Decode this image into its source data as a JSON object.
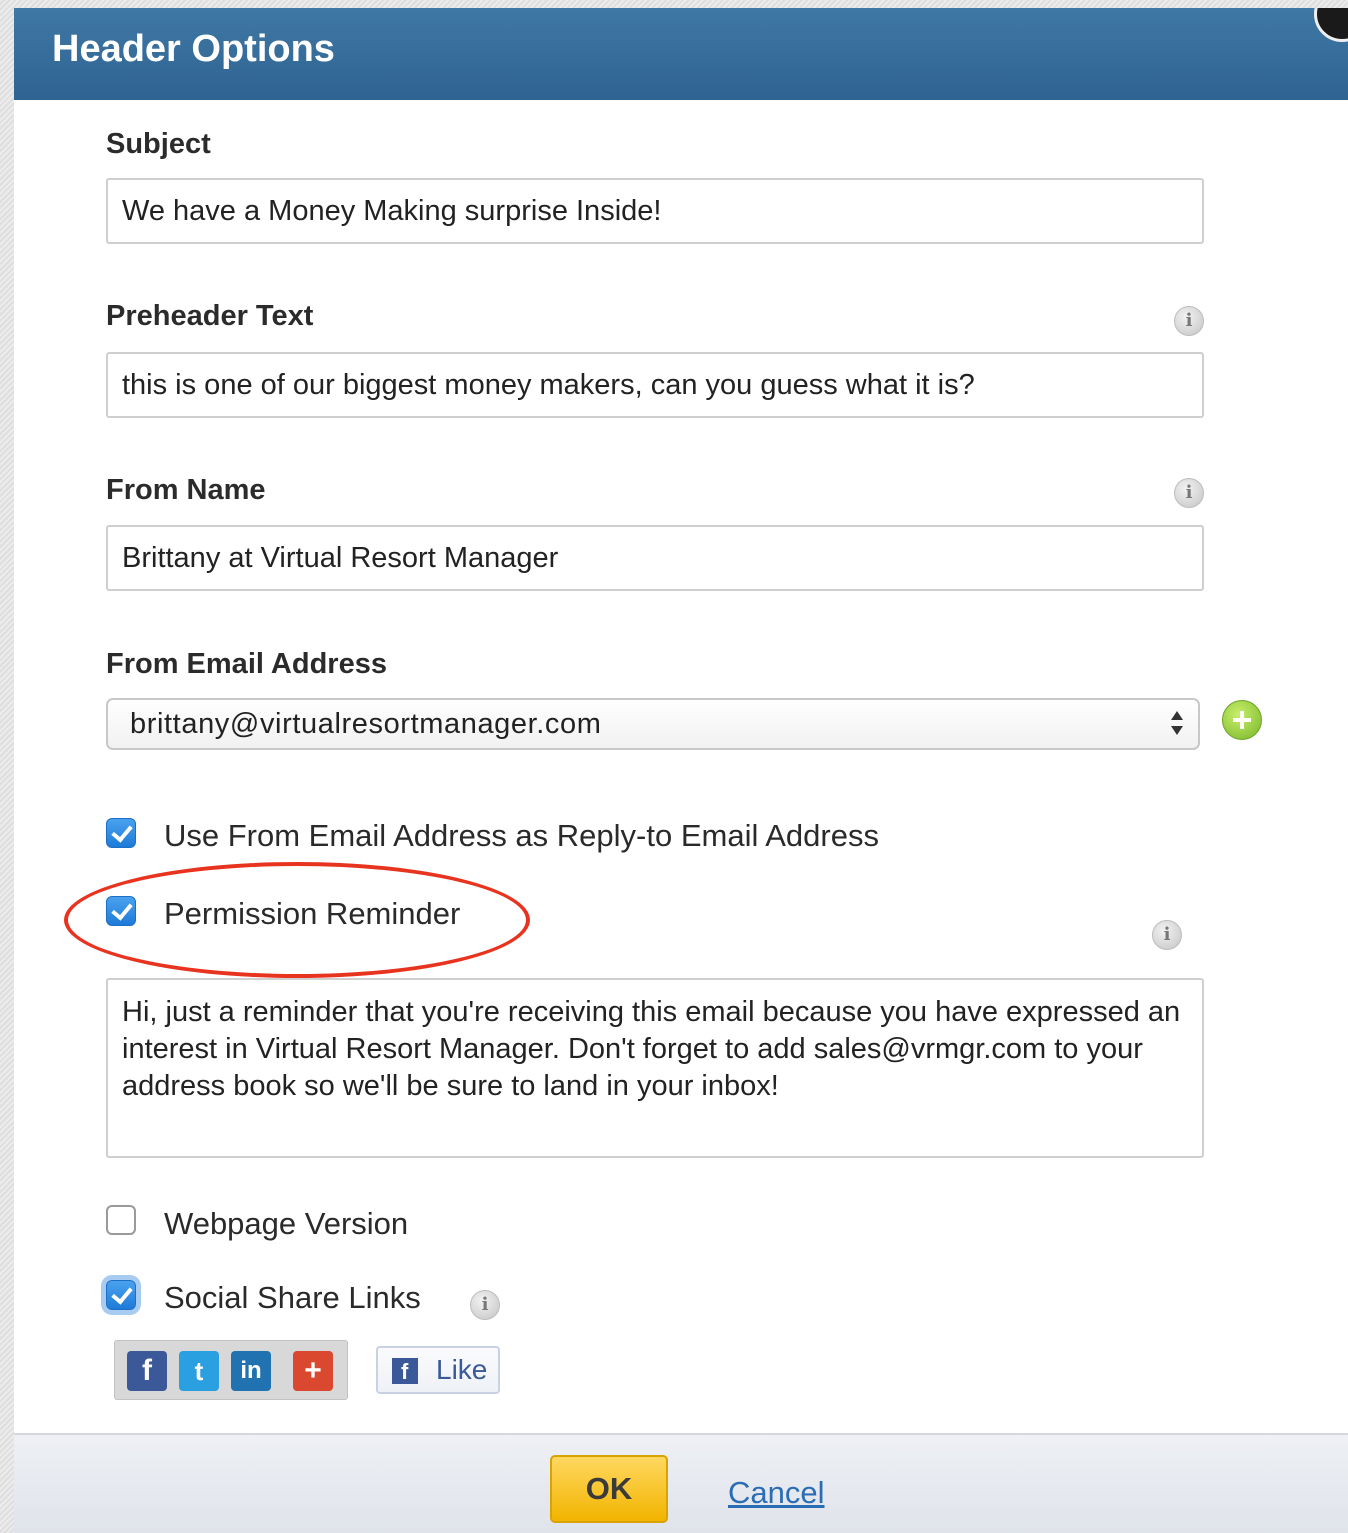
{
  "dialog": {
    "title": "Header Options"
  },
  "subject": {
    "label": "Subject",
    "value": "We have a Money Making surprise Inside!"
  },
  "preheader": {
    "label": "Preheader Text",
    "value": "this is one of our biggest money makers, can you guess what it is?"
  },
  "from_name": {
    "label": "From Name",
    "value": "Brittany at Virtual Resort Manager"
  },
  "from_email": {
    "label": "From Email Address",
    "selected": "brittany@virtualresortmanager.com"
  },
  "options": {
    "reply_to": {
      "label": "Use From Email Address as Reply-to Email Address",
      "checked": true
    },
    "permission_reminder": {
      "label": "Permission Reminder",
      "checked": true
    },
    "permission_text": "Hi, just a reminder that you're receiving this email because you have expressed an interest in Virtual Resort Manager. Don't forget to add sales@vrmgr.com to your address book so we'll be sure to land in your inbox!",
    "webpage_version": {
      "label": "Webpage Version",
      "checked": false
    },
    "social_share": {
      "label": "Social Share Links",
      "checked": true
    }
  },
  "social": {
    "icons": [
      "facebook-icon",
      "twitter-icon",
      "linkedin-icon",
      "google-plus-icon"
    ],
    "like_label": "Like"
  },
  "footer": {
    "ok_label": "OK",
    "cancel_label": "Cancel"
  },
  "colors": {
    "titlebar": "#2f6391",
    "checkbox": "#1e7ad8",
    "ok_button": "#f2b400",
    "highlight": "#e8331f"
  }
}
